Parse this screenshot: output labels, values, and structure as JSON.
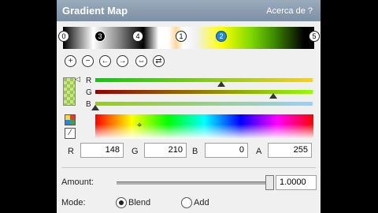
{
  "window": {
    "title": "Gradient Map",
    "about_link": "Acerca de  ?"
  },
  "gradient": {
    "stops": [
      "0",
      "3",
      "4",
      "1",
      "2",
      "5"
    ],
    "selected_stop": "2"
  },
  "toolbar": {
    "icons": [
      "add-stop-icon",
      "remove-stop-icon",
      "move-left-icon",
      "move-right-icon",
      "distribute-icon",
      "reverse-icon"
    ]
  },
  "channels": {
    "r_label": "R",
    "g_label": "G",
    "b_label": "B",
    "r_level": 0.58,
    "g_level": 0.82,
    "b_level": 0.0,
    "colors": {
      "r": "#94d200",
      "g": "#94d200",
      "b": "#94d200"
    }
  },
  "color_values": {
    "r_label": "R",
    "r_value": "148",
    "g_label": "G",
    "g_value": "210",
    "b_label": "B",
    "b_value": "0",
    "a_label": "A",
    "a_value": "255"
  },
  "amount": {
    "label": "Amount:",
    "value": "1.0000",
    "level": 1.0
  },
  "mode": {
    "label": "Mode:",
    "options": [
      "Blend",
      "Add"
    ],
    "selected": "Blend"
  }
}
